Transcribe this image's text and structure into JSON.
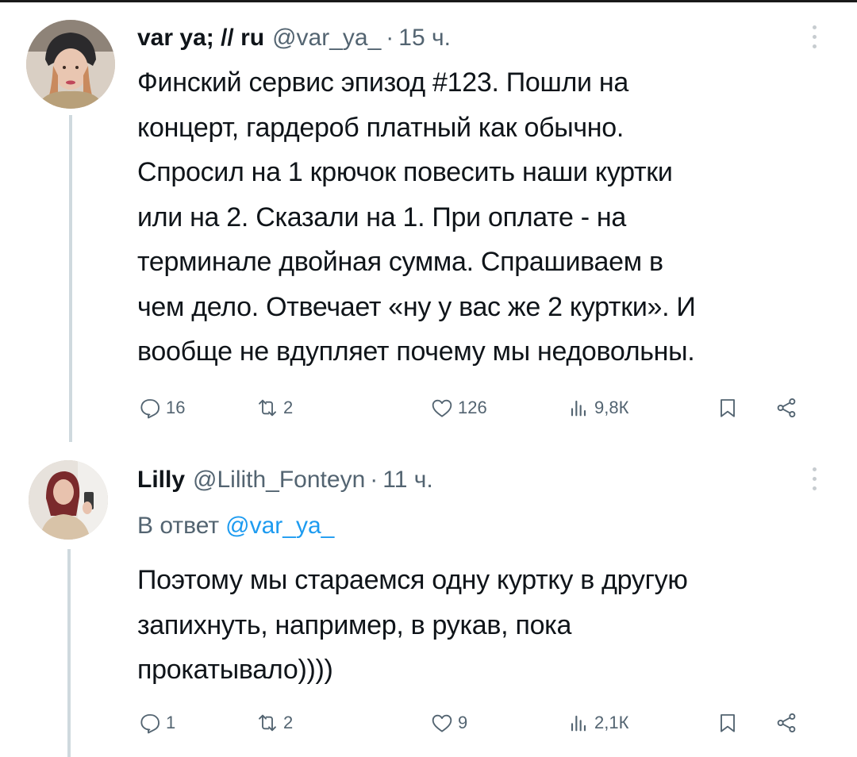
{
  "tweets": [
    {
      "display_name": "var ya; // ru",
      "handle": "@var_ya_",
      "separator": "·",
      "time": "15 ч.",
      "body_lines": [
        "Финский сервис эпизод #123. Пошли на",
        "концерт, гардероб  платный как обычно.",
        "Спросил на 1 крючок повесить наши куртки",
        "или на 2. Сказали на 1. При оплате - на",
        "терминале двойная сумма. Спрашиваем в",
        "чем дело. Отвечает «ну у вас же 2 куртки». И",
        "вообще не вдупляет почему мы недовольны."
      ],
      "stats": {
        "replies": "16",
        "retweets": "2",
        "likes": "126",
        "views": "9,8К"
      }
    },
    {
      "display_name": "Lilly",
      "handle": "@Lilith_Fonteyn",
      "separator": "·",
      "time": "11 ч.",
      "reply_prefix": "В ответ",
      "reply_mention": "@var_ya_",
      "body_lines": [
        "Поэтому мы стараемся одну куртку в другую",
        "запихнуть, например, в рукав, пока",
        "прокатывало))))"
      ],
      "stats": {
        "replies": "1",
        "retweets": "2",
        "likes": "9",
        "views": "2,1К"
      }
    }
  ],
  "icons": {
    "reply": "speech-bubble-icon",
    "retweet": "retweet-icon",
    "like": "heart-icon",
    "views": "bar-chart-icon",
    "bookmark": "bookmark-icon",
    "share": "share-icon",
    "more": "more-vertical-icon"
  },
  "colors": {
    "text": "#0f1419",
    "secondary": "#536471",
    "link": "#1d9bf0",
    "thread_line": "#cfd9de"
  }
}
